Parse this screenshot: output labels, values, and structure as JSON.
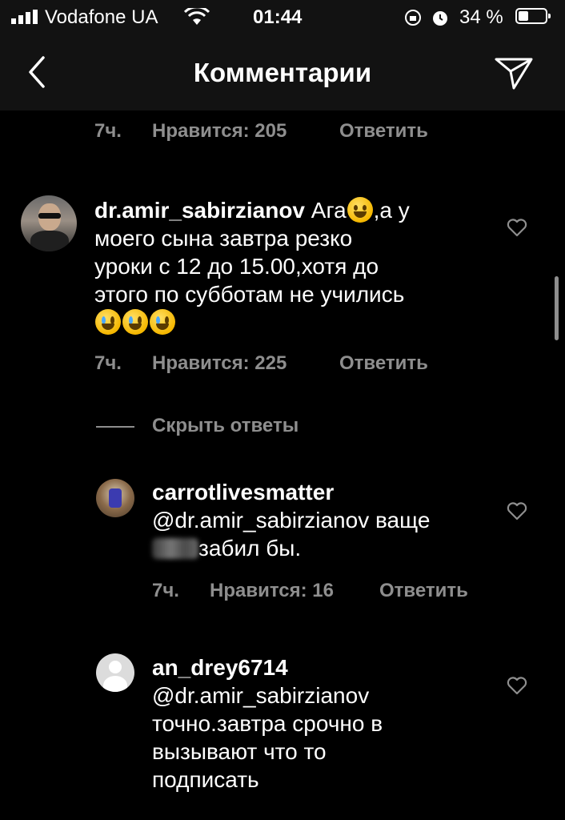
{
  "status": {
    "carrier": "Vodafone UA",
    "time": "01:44",
    "battery": "34 %"
  },
  "header": {
    "title": "Комментарии"
  },
  "comments": [
    {
      "age": "7ч.",
      "likes": "Нравится: 205",
      "reply": "Ответить"
    },
    {
      "username": "dr.amir_sabirzianov",
      "line1": "Ага",
      "line1b": ",а у",
      "line2": "моего сына завтра резко",
      "line3": "уроки с 12 до 15.00,хотя до",
      "line4": "этого по субботам не учились",
      "age": "7ч.",
      "likes": "Нравится: 225",
      "reply": "Ответить"
    }
  ],
  "hide_replies": "Скрыть ответы",
  "replies": [
    {
      "username": "carrotlivesmatter",
      "line1": "@dr.amir_sabirzianov ваще",
      "line2": "забил бы.",
      "age": "7ч.",
      "likes": "Нравится: 16",
      "reply": "Ответить"
    },
    {
      "username": "an_drey6714",
      "line1": "@dr.amir_sabirzianov",
      "line2": "точно.завтра срочно в",
      "line3": "вызывают что то",
      "line4": "подписать"
    }
  ],
  "icons": {
    "back": "chevron-left-icon",
    "send": "paper-plane-icon",
    "like": "heart-icon",
    "emoji_grin": "grinning-face-emoji",
    "emoji_cry": "tears-of-joy-emoji"
  }
}
